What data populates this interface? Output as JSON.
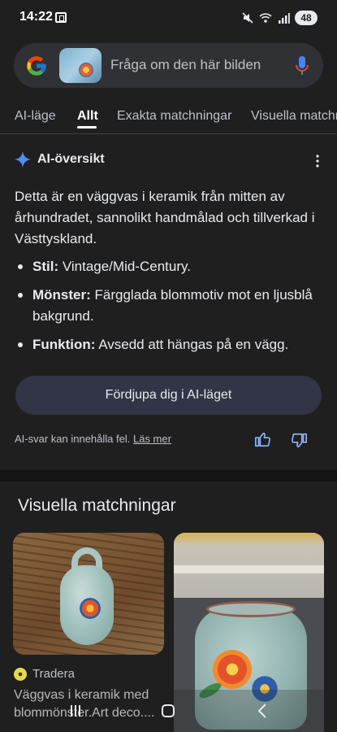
{
  "status": {
    "time": "14:22",
    "battery": "48"
  },
  "search": {
    "placeholder": "Fråga om den här bilden"
  },
  "tabs": [
    {
      "label": "AI-läge"
    },
    {
      "label": "Allt"
    },
    {
      "label": "Exakta matchningar"
    },
    {
      "label": "Visuella matchningar"
    }
  ],
  "ai_overview": {
    "title": "AI-översikt",
    "summary": "Detta är en väggvas i keramik från mitten av århundradet, sannolikt handmålad och tillverkad i Västtyskland.",
    "bullets": [
      {
        "label": "Stil:",
        "text": " Vintage/Mid-Century."
      },
      {
        "label": "Mönster:",
        "text": " Färgglada blommotiv mot en ljusblå bakgrund."
      },
      {
        "label": "Funktion:",
        "text": " Avsedd att hängas på en vägg."
      }
    ],
    "deep_dive_button": "Fördjupa dig i AI-läget",
    "disclaimer": "AI-svar kan innehålla fel.",
    "learn_more": "Läs mer"
  },
  "visual_matches": {
    "title": "Visuella matchningar",
    "cards": [
      {
        "source": "Tradera",
        "title": "Väggvas i keramik med blommönster.Art deco...."
      }
    ]
  },
  "icons": {
    "google": "google-g-icon",
    "mic": "mic-icon",
    "ai": "sparkle-icon",
    "more": "more-vert-icon",
    "thumb_up": "thumb-up-icon",
    "thumb_down": "thumb-down-icon"
  },
  "colors": {
    "background": "#1f1f1f",
    "search_bg": "#303134",
    "button_bg": "#323545",
    "ai_blue": "#4f8df5"
  }
}
